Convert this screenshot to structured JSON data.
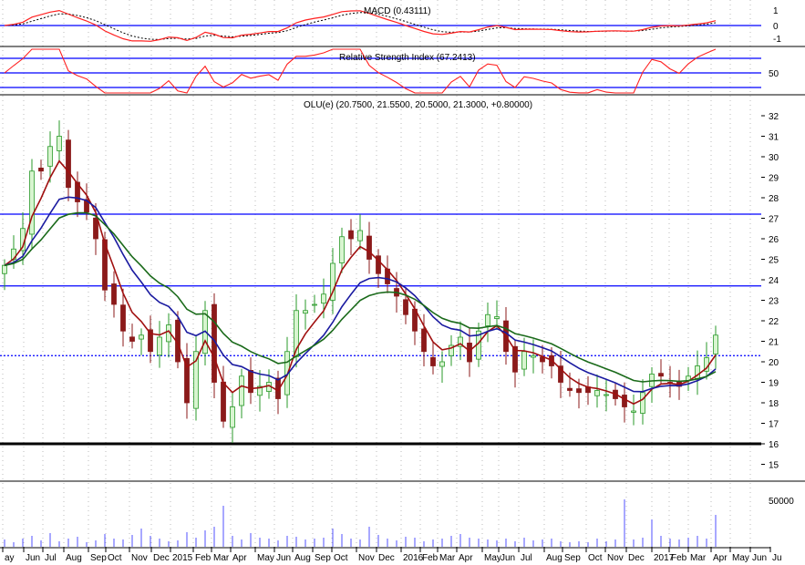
{
  "chart_data": {
    "type": "candlestick",
    "title": "OLU(e) (20.7500, 21.5500, 20.5000, 21.3000, +0.80000)",
    "macd_label": "MACD (0.43111)",
    "rsi_label": "Relative Strength Index (67.2413)",
    "macd_ticks": [
      "1",
      "0",
      "-1"
    ],
    "rsi_ticks": [
      "50"
    ],
    "price_ticks": [
      "32",
      "31",
      "30",
      "29",
      "28",
      "27",
      "26",
      "25",
      "24",
      "23",
      "22",
      "21",
      "20",
      "19",
      "18",
      "17",
      "16",
      "15"
    ],
    "volume_ticks": [
      "50000"
    ],
    "x_labels": [
      "ay",
      "Jun",
      "Jul",
      "Aug",
      "Sep",
      "Oct",
      "Nov",
      "Dec",
      "2015",
      "Feb",
      "Mar",
      "Apr",
      "May",
      "Jun",
      "Aug",
      "Sep",
      "Oct",
      "Nov",
      "Dec",
      "2016",
      "Feb",
      "Mar",
      "Apr",
      "May",
      "Jun",
      "Jul",
      "Aug",
      "Sep",
      "Oct",
      "Nov",
      "Dec",
      "2017",
      "Feb",
      "Mar",
      "Apr",
      "May",
      "Jun",
      "Ju"
    ],
    "ylim": [
      14.5,
      33
    ],
    "closes": [
      24.7,
      25.5,
      26.5,
      29.3,
      29.3,
      30.5,
      31,
      28.5,
      27.8,
      27.3,
      26,
      23.5,
      22.8,
      21.5,
      21,
      21.3,
      20.5,
      21.2,
      21.8,
      20,
      18,
      20.5,
      22.5,
      19,
      17.1,
      17.8,
      19.3,
      18.5,
      18.8,
      19,
      18.2,
      20.5,
      22.5,
      22.5,
      22.8,
      23.3,
      24.8,
      26.1,
      26,
      26.4,
      25,
      24.3,
      23.8,
      23.2,
      22.3,
      21.5,
      20.5,
      19.8,
      20,
      20.8,
      21.2,
      20,
      21.5,
      22.3,
      22.2,
      20.5,
      19.5,
      20.5,
      20.3,
      20,
      19.8,
      19,
      18.6,
      18.5,
      18.5,
      18.6,
      18.4,
      18.2,
      17.8,
      17.6,
      18.5,
      19.4,
      19.3,
      19,
      18.8,
      19.3,
      19.8,
      20.2,
      21.3
    ],
    "volumes": [
      8000,
      5000,
      9000,
      12000,
      7000,
      15000,
      6000,
      9000,
      11000,
      5000,
      7000,
      14000,
      9000,
      8000,
      13000,
      20000,
      12000,
      9000,
      6000,
      7000,
      16000,
      10000,
      18000,
      22000,
      45000,
      12000,
      8000,
      15000,
      10000,
      9000,
      7000,
      12000,
      11000,
      8000,
      9000,
      10000,
      20000,
      14000,
      9000,
      8000,
      22000,
      13000,
      9000,
      7000,
      11000,
      10000,
      6000,
      8000,
      9000,
      12000,
      14000,
      10000,
      9000,
      8000,
      7000,
      9000,
      6000,
      10000,
      7000,
      8000,
      9000,
      6000,
      5000,
      6000,
      5000,
      9000,
      6000,
      8000,
      52000,
      8000,
      10000,
      30000,
      12000,
      9000,
      8000,
      10000,
      12000,
      9000,
      35000
    ],
    "horizontal_lines": [
      {
        "value": 27.2,
        "style": "solid",
        "color": "#0000ff"
      },
      {
        "value": 23.7,
        "style": "solid",
        "color": "#0000ff"
      },
      {
        "value": 20.3,
        "style": "dotted",
        "color": "#0000ff"
      },
      {
        "value": 16,
        "style": "thick",
        "color": "#000000"
      }
    ],
    "colors": {
      "up": "#d8f5d0",
      "up_border": "#2a9a2a",
      "down": "#8b1a1a",
      "ma_short": "#a01010",
      "ma_mid": "#1a1aa0",
      "ma_long": "#1a6a1a",
      "macd": "#ff2020",
      "rsi": "#ff2020",
      "volume": "#5050ff"
    }
  }
}
